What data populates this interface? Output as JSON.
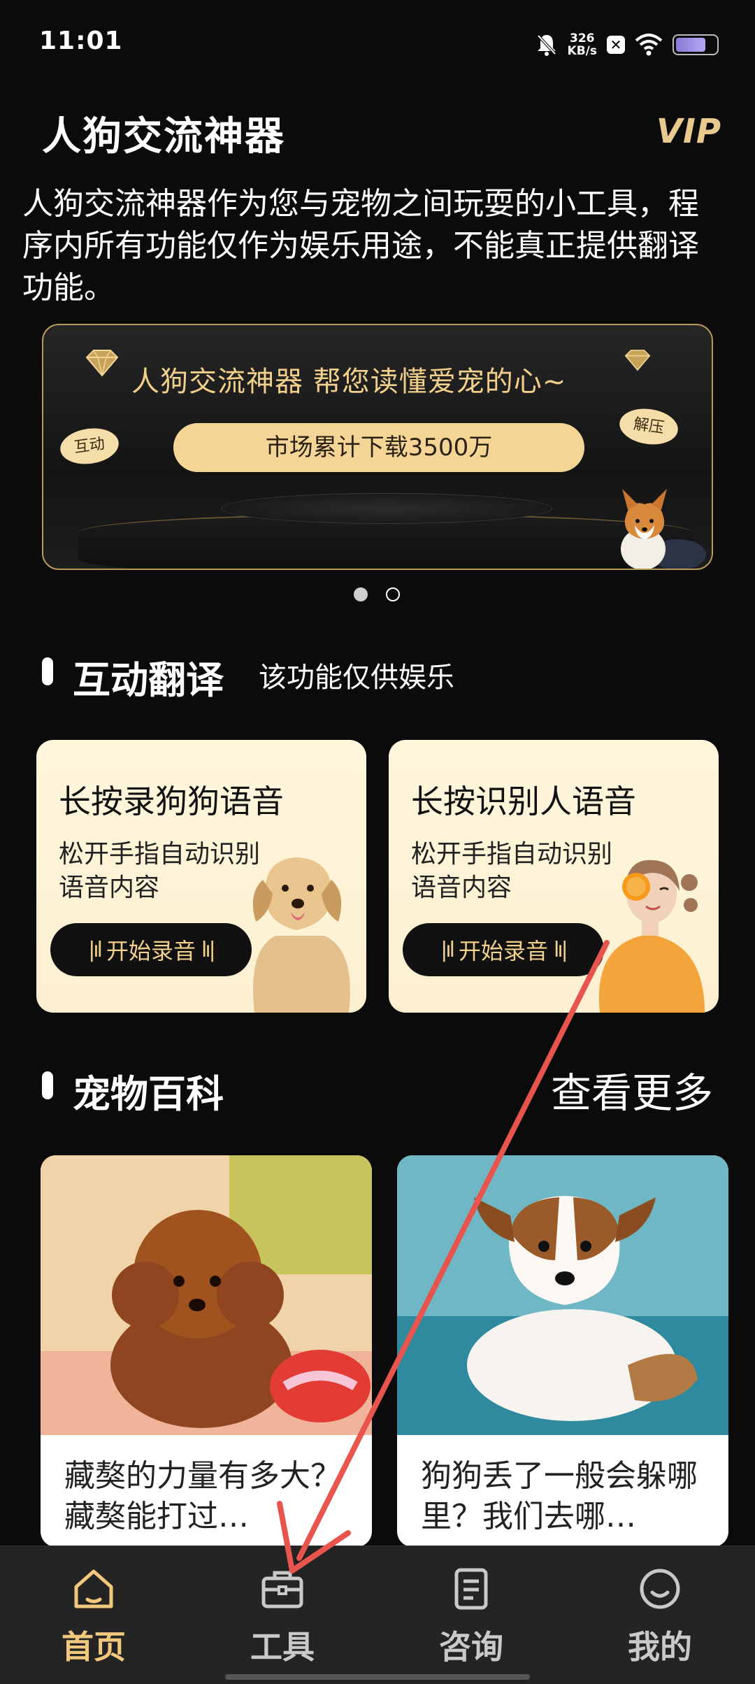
{
  "status_bar": {
    "time": "11:01",
    "net_speed_value": "326",
    "net_speed_unit": "KB/s",
    "battery_level": 0.75
  },
  "header": {
    "title": "人狗交流神器",
    "vip": "VIP"
  },
  "disclaimer": "人狗交流神器作为您与宠物之间玩耍的小工具，程序内所有功能仅作为娱乐用途，不能真正提供翻译功能。",
  "banner": {
    "title": "人狗交流神器 帮您读懂爱宠的心~",
    "pill": "市场累计下载3500万",
    "tag_left": "互动",
    "tag_right": "解压"
  },
  "carousel": {
    "count": 2,
    "active": 0
  },
  "translate_section": {
    "title": "互动翻译",
    "subtitle": "该功能仅供娱乐",
    "cards": [
      {
        "title": "长按录狗狗语音",
        "desc": "松开手指自动识别语音内容",
        "button": "开始录音"
      },
      {
        "title": "长按识别人语音",
        "desc": "松开手指自动识别语音内容",
        "button": "开始录音"
      }
    ]
  },
  "wiki_section": {
    "title": "宠物百科",
    "more": "查看更多",
    "articles": [
      {
        "title": "藏獒的力量有多大？藏獒能打过…"
      },
      {
        "title": "狗狗丢了一般会躲哪里？我们去哪…"
      }
    ]
  },
  "bottom_nav": {
    "items": [
      {
        "label": "首页",
        "icon": "home-icon",
        "active": true
      },
      {
        "label": "工具",
        "icon": "toolbox-icon",
        "active": false
      },
      {
        "label": "咨询",
        "icon": "document-icon",
        "active": false
      },
      {
        "label": "我的",
        "icon": "smile-icon",
        "active": false
      }
    ]
  },
  "colors": {
    "accent_gold": "#f1c87c",
    "card_bg": "#fdf0d1",
    "annotation_arrow": "#e8554e"
  }
}
